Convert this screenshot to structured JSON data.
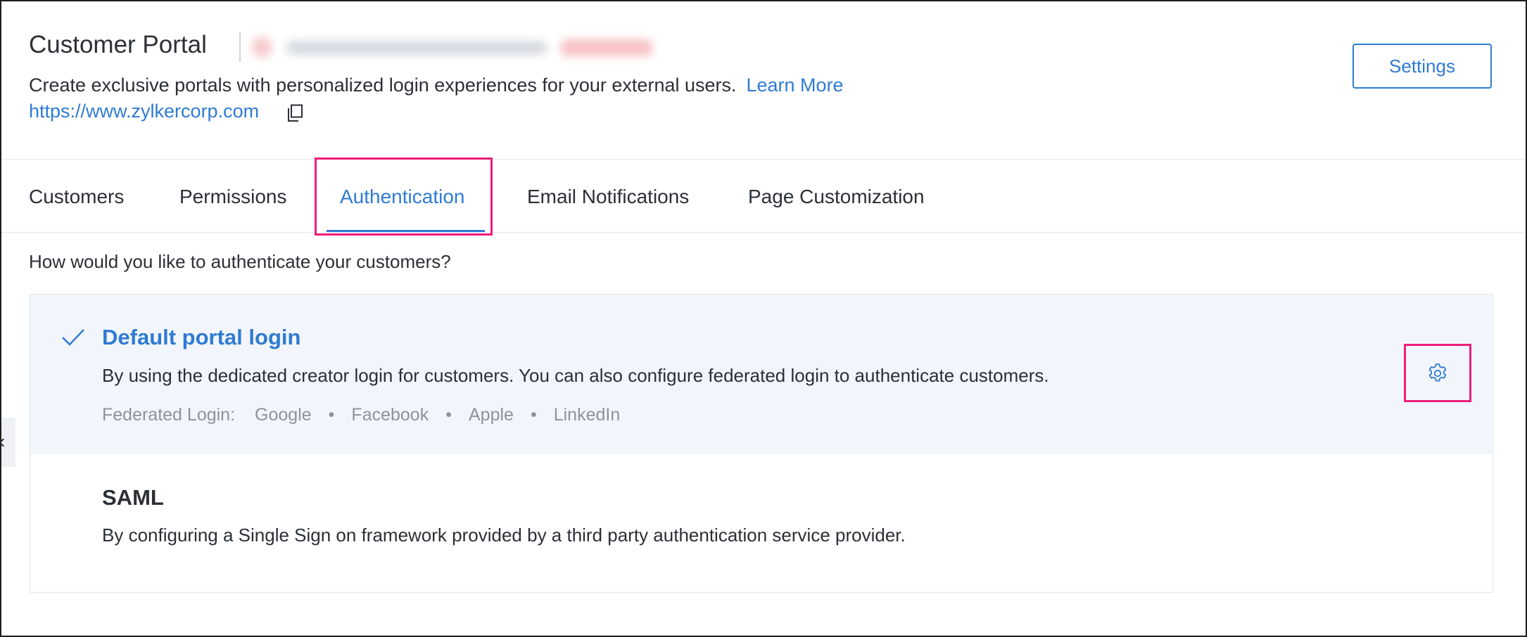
{
  "header": {
    "title": "Customer Portal",
    "description": "Create exclusive portals with personalized login experiences for your external users.",
    "learn_more": "Learn More",
    "url": "https://www.zylkercorp.com",
    "settings_label": "Settings",
    "copy_icon": "copy-icon"
  },
  "tabs": [
    {
      "label": "Customers"
    },
    {
      "label": "Permissions"
    },
    {
      "label": "Authentication",
      "active": true
    },
    {
      "label": "Email Notifications"
    },
    {
      "label": "Page Customization"
    }
  ],
  "authentication": {
    "question": "How would you like to authenticate your customers?",
    "options": [
      {
        "title": "Default portal login",
        "selected": true,
        "description": "By using the dedicated creator login for customers. You can also configure federated login to authenticate customers.",
        "federated_label": "Federated Login:",
        "federated": [
          "Google",
          "Facebook",
          "Apple",
          "LinkedIn"
        ],
        "separator": "•",
        "icon": "gear-icon"
      },
      {
        "title": "SAML",
        "selected": false,
        "description": "By configuring a Single Sign on framework provided by a third party authentication service provider."
      }
    ]
  },
  "side_handle": "‹",
  "colors": {
    "accent": "#2f7bd3",
    "highlight": "#ee1d7a",
    "selected_bg": "#f2f6fc",
    "muted_text": "#8d939b"
  }
}
